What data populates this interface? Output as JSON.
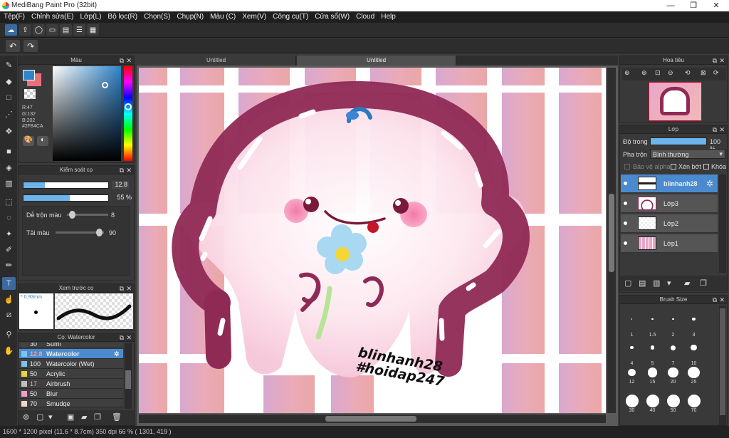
{
  "window": {
    "title": "MediBang Paint Pro (32bit)",
    "min": "—",
    "restore": "❐",
    "close": "✕"
  },
  "menu": [
    "Tệp(F)",
    "Chỉnh sửa(E)",
    "Lớp(L)",
    "Bộ lọc(R)",
    "Chọn(S)",
    "Chụp(N)",
    "Màu (C)",
    "Xem(V)",
    "Công cụ(T)",
    "Cửa sổ(W)",
    "Cloud",
    "Help"
  ],
  "panels": {
    "color": {
      "title": "Màu",
      "r": "R:47",
      "g": "G:132",
      "b": "B:202",
      "hex": "#2F84CA",
      "current": "#2F84CA",
      "secondary": "#e8707c"
    },
    "brush_control": {
      "title": "Kiểm soát cọ",
      "size": "12.8",
      "opacity": "55 %",
      "size_fill": 0.25,
      "opacity_fill": 0.55,
      "mix_label": "Dễ trộn màu",
      "mix_value": "8",
      "mix_fill": 0.08,
      "paint_label": "Tải màu",
      "paint_value": "90",
      "paint_fill": 0.9
    },
    "preview": {
      "title": "Xem trước cọ",
      "size": "* 0.93mm"
    },
    "brush": {
      "title": "Cọ: Watercolor",
      "rows": [
        {
          "size": "30",
          "name": "Sumi",
          "color": "#444444"
        },
        {
          "size": "12.8",
          "name": "Watercolor",
          "color": "#7cc4f0"
        },
        {
          "size": "100",
          "name": "Watercolor (Wet)",
          "color": "#7cc4f0"
        },
        {
          "size": "50",
          "name": "Acrylic",
          "color": "#e8d43a"
        },
        {
          "size": "17",
          "name": "Airbrush",
          "color": "#bfbfbf"
        },
        {
          "size": "50",
          "name": "Blur",
          "color": "#f0a0c8"
        },
        {
          "size": "70",
          "name": "Smudge",
          "color": "#f4d8c4"
        }
      ]
    },
    "navigator": {
      "title": "Hoa tiêu"
    },
    "layer": {
      "title": "Lớp",
      "opacity_label": "Độ trong",
      "opacity_value": "100 %",
      "blend_label": "Pha trộn",
      "blend_value": "Bình thường",
      "alpha_protect": "Bảo vệ alpha",
      "clipping": "Xén bớt",
      "lock": "Khóa",
      "layers": [
        {
          "name": "blinhanh28",
          "selected": true
        },
        {
          "name": "Lớp3",
          "selected": false
        },
        {
          "name": "Lớp2",
          "selected": false
        },
        {
          "name": "Lớp1",
          "selected": false
        }
      ]
    },
    "brush_size": {
      "title": "Brush Size",
      "sizes": [
        "1",
        "1.5",
        "2",
        "3",
        "4",
        "5",
        "7",
        "10",
        "12",
        "15",
        "20",
        "25",
        "30",
        "40",
        "50",
        "70"
      ]
    }
  },
  "canvas": {
    "tabs": [
      "Untitled",
      "Untitled"
    ],
    "watermark_line1": "blinhanh28",
    "watermark_line2": "#hoidap247"
  },
  "status": {
    "text": "1600 * 1200 pixel   (11.6 * 8.7cm)   350 dpi   66 %   ( 1301, 419 )"
  }
}
